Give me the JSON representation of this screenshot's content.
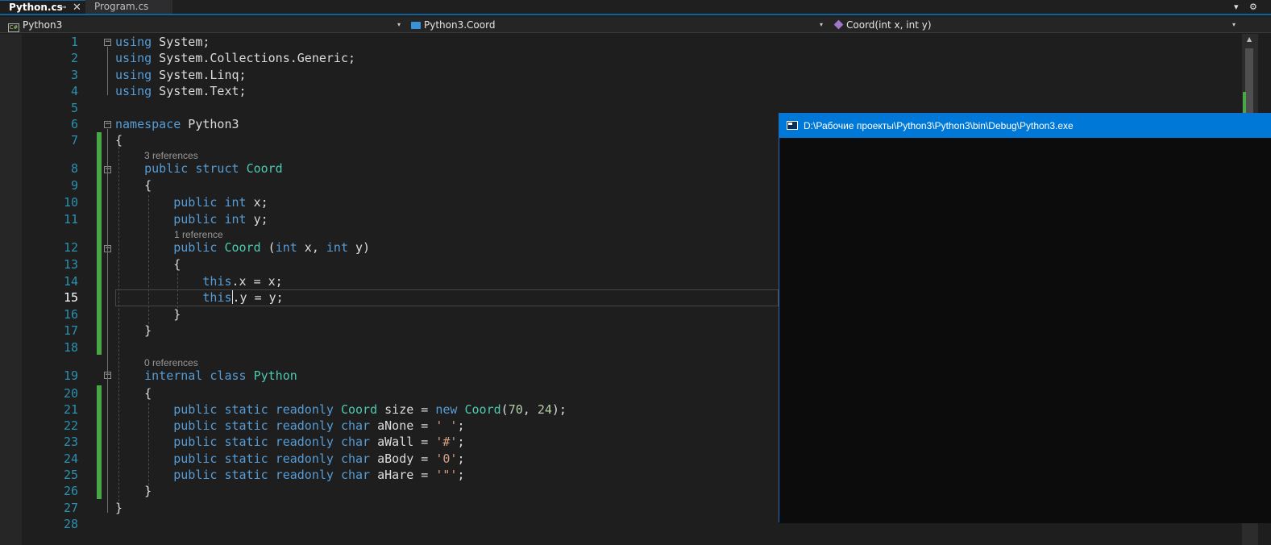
{
  "tabs": [
    {
      "label": "Python.cs",
      "active": true,
      "pin_glyph": "⊸",
      "close_glyph": "✕"
    },
    {
      "label": "Program.cs",
      "active": false
    }
  ],
  "tabstrip": {
    "overflow_glyph": "▾",
    "settings_glyph": "⚙"
  },
  "navbar": {
    "project": "Python3",
    "type": "Python3.Coord",
    "member": "Coord(int x, int y)",
    "dropdown_glyph": "▾"
  },
  "editor": {
    "current_line": 15,
    "lines": [
      {
        "n": "1",
        "tokens": [
          [
            "kw",
            "using"
          ],
          [
            "pl",
            " System;"
          ]
        ]
      },
      {
        "n": "2",
        "tokens": [
          [
            "kw",
            "using"
          ],
          [
            "pl",
            " System.Collections.Generic;"
          ]
        ]
      },
      {
        "n": "3",
        "tokens": [
          [
            "kw",
            "using"
          ],
          [
            "pl",
            " System.Linq;"
          ]
        ]
      },
      {
        "n": "4",
        "tokens": [
          [
            "kw",
            "using"
          ],
          [
            "pl",
            " System.Text;"
          ]
        ]
      },
      {
        "n": "5",
        "tokens": []
      },
      {
        "n": "6",
        "tokens": [
          [
            "kw",
            "namespace"
          ],
          [
            "pl",
            " Python3"
          ]
        ]
      },
      {
        "n": "7",
        "tokens": [
          [
            "pl",
            "{"
          ]
        ]
      },
      {
        "n": "8",
        "ref": "3 references",
        "tokens": [
          [
            "pl",
            "    "
          ],
          [
            "kw",
            "public"
          ],
          [
            "pl",
            " "
          ],
          [
            "kw",
            "struct"
          ],
          [
            "pl",
            " "
          ],
          [
            "ty",
            "Coord"
          ]
        ]
      },
      {
        "n": "9",
        "tokens": [
          [
            "pl",
            "    {"
          ]
        ]
      },
      {
        "n": "10",
        "tokens": [
          [
            "pl",
            "        "
          ],
          [
            "kw",
            "public"
          ],
          [
            "pl",
            " "
          ],
          [
            "kw",
            "int"
          ],
          [
            "pl",
            " x;"
          ]
        ]
      },
      {
        "n": "11",
        "tokens": [
          [
            "pl",
            "        "
          ],
          [
            "kw",
            "public"
          ],
          [
            "pl",
            " "
          ],
          [
            "kw",
            "int"
          ],
          [
            "pl",
            " y;"
          ]
        ]
      },
      {
        "n": "12",
        "ref": "1 reference",
        "tokens": [
          [
            "pl",
            "        "
          ],
          [
            "kw",
            "public"
          ],
          [
            "pl",
            " "
          ],
          [
            "ty",
            "Coord"
          ],
          [
            "pl",
            " ("
          ],
          [
            "kw",
            "int"
          ],
          [
            "pl",
            " x, "
          ],
          [
            "kw",
            "int"
          ],
          [
            "pl",
            " y)"
          ]
        ]
      },
      {
        "n": "13",
        "tokens": [
          [
            "pl",
            "        {"
          ]
        ]
      },
      {
        "n": "14",
        "tokens": [
          [
            "pl",
            "            "
          ],
          [
            "kw",
            "this"
          ],
          [
            "pl",
            ".x = x;"
          ]
        ]
      },
      {
        "n": "15",
        "tokens": [
          [
            "pl",
            "            "
          ],
          [
            "kw",
            "this"
          ],
          [
            "caret",
            ""
          ],
          [
            "pl",
            ".y = y;"
          ]
        ]
      },
      {
        "n": "16",
        "tokens": [
          [
            "pl",
            "        }"
          ]
        ]
      },
      {
        "n": "17",
        "tokens": [
          [
            "pl",
            "    }"
          ]
        ]
      },
      {
        "n": "18",
        "tokens": []
      },
      {
        "n": "19",
        "ref": "0 references",
        "tokens": [
          [
            "pl",
            "    "
          ],
          [
            "kw",
            "internal"
          ],
          [
            "pl",
            " "
          ],
          [
            "kw",
            "class"
          ],
          [
            "pl",
            " "
          ],
          [
            "ty",
            "Python"
          ]
        ]
      },
      {
        "n": "20",
        "tokens": [
          [
            "pl",
            "    {"
          ]
        ]
      },
      {
        "n": "21",
        "tokens": [
          [
            "pl",
            "        "
          ],
          [
            "kw",
            "public"
          ],
          [
            "pl",
            " "
          ],
          [
            "kw",
            "static"
          ],
          [
            "pl",
            " "
          ],
          [
            "kw",
            "readonly"
          ],
          [
            "pl",
            " "
          ],
          [
            "ty",
            "Coord"
          ],
          [
            "pl",
            " size = "
          ],
          [
            "kw",
            "new"
          ],
          [
            "pl",
            " "
          ],
          [
            "ty",
            "Coord"
          ],
          [
            "pl",
            "("
          ],
          [
            "nm",
            "70"
          ],
          [
            "pl",
            ", "
          ],
          [
            "nm",
            "24"
          ],
          [
            "pl",
            ");"
          ]
        ]
      },
      {
        "n": "22",
        "tokens": [
          [
            "pl",
            "        "
          ],
          [
            "kw",
            "public"
          ],
          [
            "pl",
            " "
          ],
          [
            "kw",
            "static"
          ],
          [
            "pl",
            " "
          ],
          [
            "kw",
            "readonly"
          ],
          [
            "pl",
            " "
          ],
          [
            "kw",
            "char"
          ],
          [
            "pl",
            " aNone = "
          ],
          [
            "st2",
            "' '"
          ],
          [
            "pl",
            ";"
          ]
        ]
      },
      {
        "n": "23",
        "tokens": [
          [
            "pl",
            "        "
          ],
          [
            "kw",
            "public"
          ],
          [
            "pl",
            " "
          ],
          [
            "kw",
            "static"
          ],
          [
            "pl",
            " "
          ],
          [
            "kw",
            "readonly"
          ],
          [
            "pl",
            " "
          ],
          [
            "kw",
            "char"
          ],
          [
            "pl",
            " aWall = "
          ],
          [
            "st2",
            "'#'"
          ],
          [
            "pl",
            ";"
          ]
        ]
      },
      {
        "n": "24",
        "tokens": [
          [
            "pl",
            "        "
          ],
          [
            "kw",
            "public"
          ],
          [
            "pl",
            " "
          ],
          [
            "kw",
            "static"
          ],
          [
            "pl",
            " "
          ],
          [
            "kw",
            "readonly"
          ],
          [
            "pl",
            " "
          ],
          [
            "kw",
            "char"
          ],
          [
            "pl",
            " aBody = "
          ],
          [
            "st2",
            "'0'"
          ],
          [
            "pl",
            ";"
          ]
        ]
      },
      {
        "n": "25",
        "tokens": [
          [
            "pl",
            "        "
          ],
          [
            "kw",
            "public"
          ],
          [
            "pl",
            " "
          ],
          [
            "kw",
            "static"
          ],
          [
            "pl",
            " "
          ],
          [
            "kw",
            "readonly"
          ],
          [
            "pl",
            " "
          ],
          [
            "kw",
            "char"
          ],
          [
            "pl",
            " aHare = "
          ],
          [
            "st2",
            "'\"'"
          ],
          [
            "pl",
            ";"
          ]
        ]
      },
      {
        "n": "26",
        "tokens": [
          [
            "pl",
            "    }"
          ]
        ]
      },
      {
        "n": "27",
        "tokens": [
          [
            "pl",
            "}"
          ]
        ]
      },
      {
        "n": "28",
        "tokens": []
      }
    ]
  },
  "console": {
    "title": "D:\\Рабочие проекты\\Python3\\Python3\\bin\\Debug\\Python3.exe"
  },
  "colors": {
    "accent": "#0e639c",
    "keyword": "#569cd6",
    "type": "#4ec9b0",
    "string": "#d69d85",
    "number": "#b5cea8",
    "line_number": "#2b91af",
    "change_bar": "#4aa745",
    "console_title_bg": "#0078d7"
  }
}
